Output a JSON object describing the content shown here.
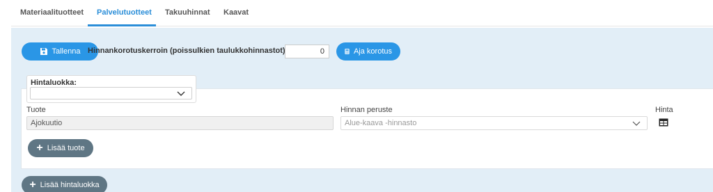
{
  "tabs": [
    {
      "label": "Materiaalituotteet",
      "active": false
    },
    {
      "label": "Palvelutuotteet",
      "active": true
    },
    {
      "label": "Takuuhinnat",
      "active": false
    },
    {
      "label": "Kaavat",
      "active": false
    }
  ],
  "toolbar": {
    "save_label": "Tallenna",
    "coefficient_label": "Hinnankorotuskerroin (poissulkien taulukkohinnastot):",
    "coefficient_value": "0",
    "run_label": "Aja korotus"
  },
  "price_class": {
    "label": "Hintaluokka:",
    "selected": ""
  },
  "columns": {
    "product": "Tuote",
    "basis": "Hinnan peruste",
    "price": "Hinta"
  },
  "row": {
    "product_value": "Ajokuutio",
    "basis_placeholder": "Alue-kaava -hinnasto"
  },
  "actions": {
    "add_product_label": "Lisää tuote",
    "add_price_class_label": "Lisää hintaluokka"
  },
  "colors": {
    "accent": "#2a96e6",
    "panel_bg": "#e2eef7",
    "secondary_button": "#5f7684"
  },
  "icons": {
    "save": "floppy-disk-icon",
    "info": "info-icon",
    "calculator": "calculator-icon",
    "chevron": "chevron-down-icon",
    "table": "table-icon",
    "plus": "plus-icon"
  }
}
